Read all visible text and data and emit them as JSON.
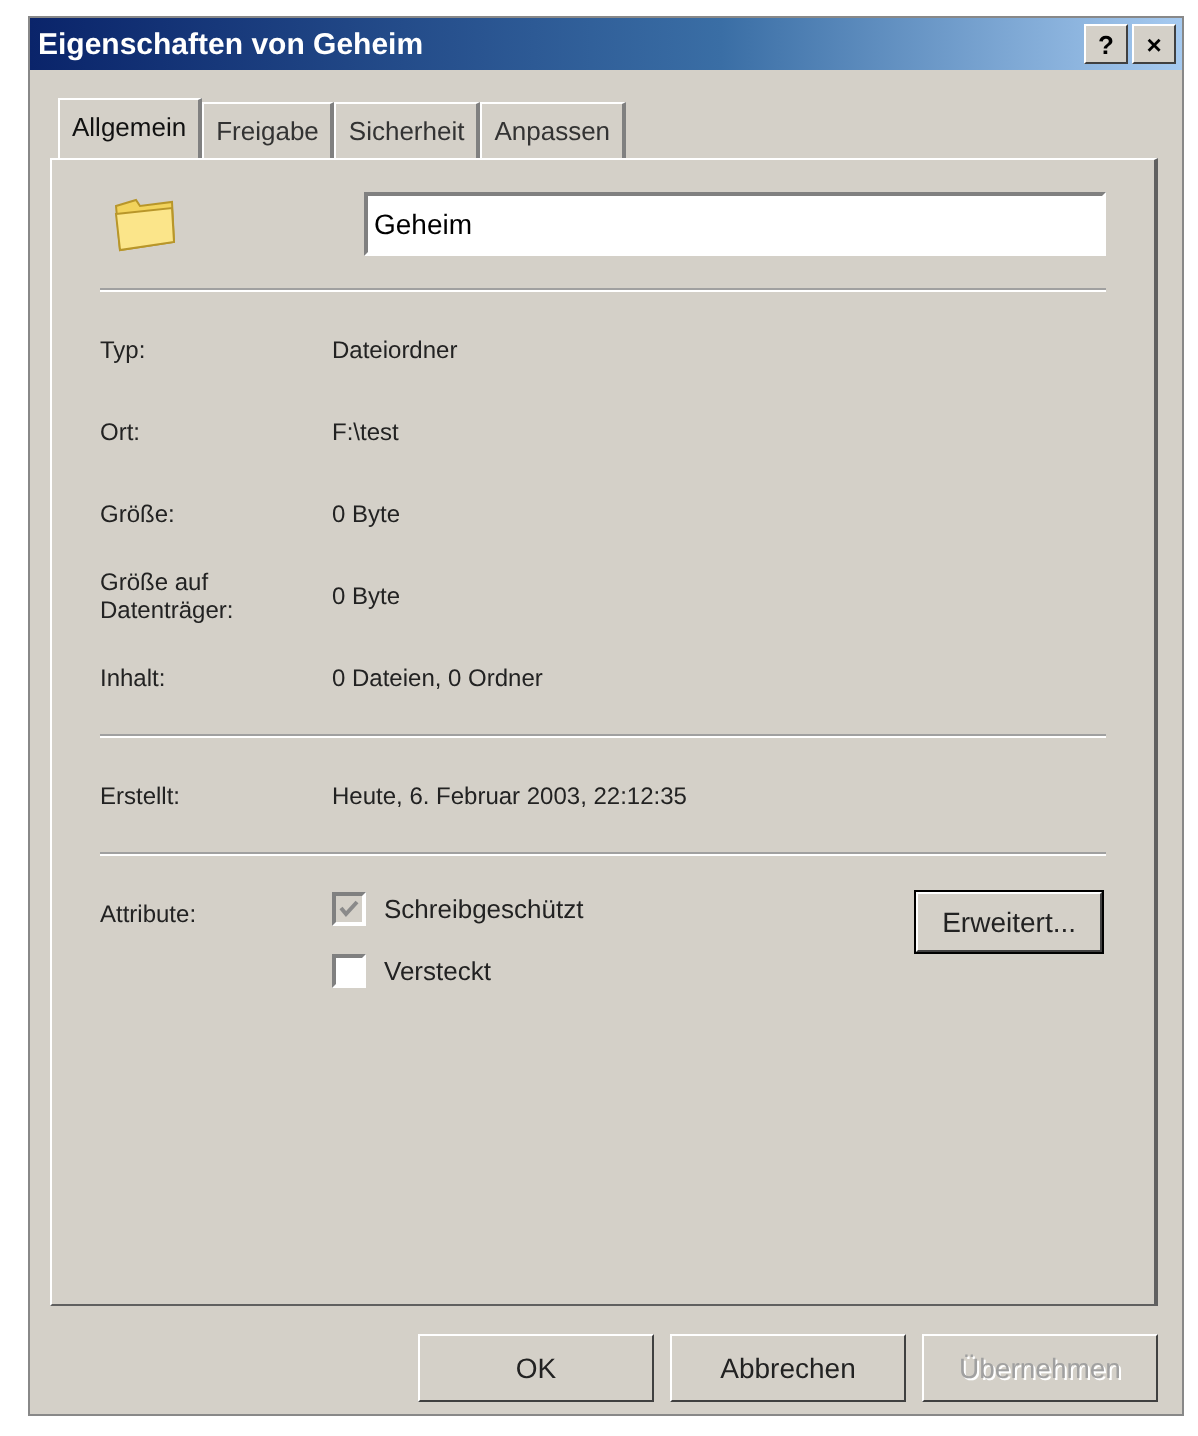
{
  "window": {
    "title": "Eigenschaften von Geheim",
    "help_button": "?",
    "close_button": "×"
  },
  "tabs": [
    {
      "label": "Allgemein",
      "selected": true
    },
    {
      "label": "Freigabe",
      "selected": false
    },
    {
      "label": "Sicherheit",
      "selected": false
    },
    {
      "label": "Anpassen",
      "selected": false
    }
  ],
  "name_field": {
    "value": "Geheim"
  },
  "groups": [
    [
      {
        "label": "Typ:",
        "value": "Dateiordner"
      },
      {
        "label": "Ort:",
        "value": "F:\\test"
      },
      {
        "label": "Größe:",
        "value": "0 Byte"
      },
      {
        "label": "Größe auf Datenträger:",
        "value": "0 Byte"
      },
      {
        "label": "Inhalt:",
        "value": "0 Dateien, 0 Ordner"
      }
    ],
    [
      {
        "label": "Erstellt:",
        "value": "Heute, 6. Februar 2003, 22:12:35"
      }
    ]
  ],
  "attributes": {
    "label": "Attribute:",
    "options": [
      {
        "label": "Schreibgeschützt",
        "checked": true,
        "disabled": true
      },
      {
        "label": "Versteckt",
        "checked": false,
        "disabled": false
      }
    ],
    "advanced_button": "Erweitert..."
  },
  "buttons": [
    {
      "label": "OK",
      "disabled": false
    },
    {
      "label": "Abbrechen",
      "disabled": false
    },
    {
      "label": "Übernehmen",
      "disabled": true
    }
  ]
}
